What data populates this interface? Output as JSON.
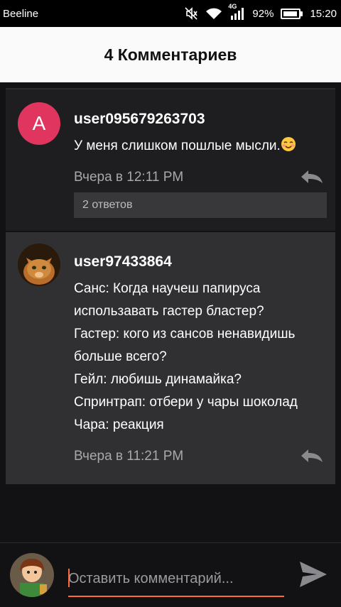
{
  "status_bar": {
    "carrier": "Beeline",
    "network": "4G",
    "battery": "92%",
    "battery_level": 0.92,
    "time": "15:20"
  },
  "header": {
    "title": "4 Комментариев"
  },
  "comments": [
    {
      "avatar_letter": "A",
      "avatar_color": "#e0355f",
      "username": "user095679263703",
      "text": "У меня слишком пошлые мысли.",
      "emoji": "smiling-blush-emoji",
      "time": "Вчера в 12:11 PM",
      "replies": "2 ответов"
    },
    {
      "avatar": "cat-photo",
      "username": "user97433864",
      "text": "Санс: Когда научеш папируса использавать гастер бластер?\nГастер: кого из сансов ненавидишь больше всего?\nГейл: любишь динамайка?\nСпринтрап: отбери у чары шоколад\nЧара: реакция",
      "time": "Вчера в 11:21 PM"
    }
  ],
  "composer": {
    "placeholder": "Оставить комментарий...",
    "accent": "#ff6a3d",
    "send_icon": "send-icon"
  }
}
